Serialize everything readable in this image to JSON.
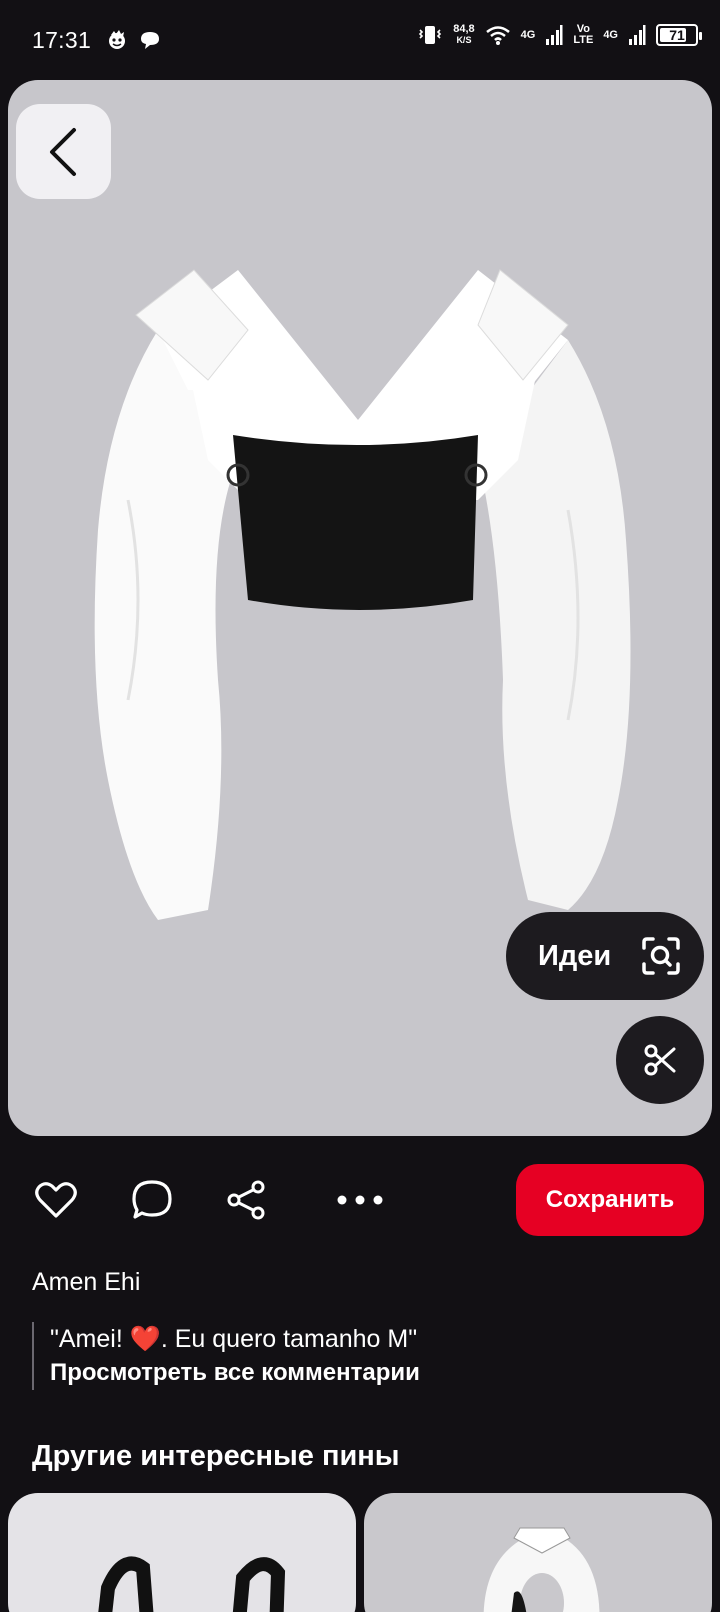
{
  "status_bar": {
    "time": "17:31",
    "net_speed_value": "84,8",
    "net_speed_unit": "K/S",
    "network_1": "4G",
    "volte_top": "Vo",
    "volte_bottom": "LTE",
    "network_2": "4G",
    "battery_level": "71"
  },
  "pin": {
    "ideas_label": "Идеи",
    "save_label": "Сохранить",
    "author": "Amen Ehi",
    "comment": "\"Amei! ❤️. Eu quero tamanho M\"",
    "view_all_comments": "Просмотреть все комментарии"
  },
  "more_pins": {
    "title": "Другие интересные пины"
  },
  "colors": {
    "background": "#121014",
    "save_button": "#e60023",
    "image_bg": "#c7c6cb"
  }
}
